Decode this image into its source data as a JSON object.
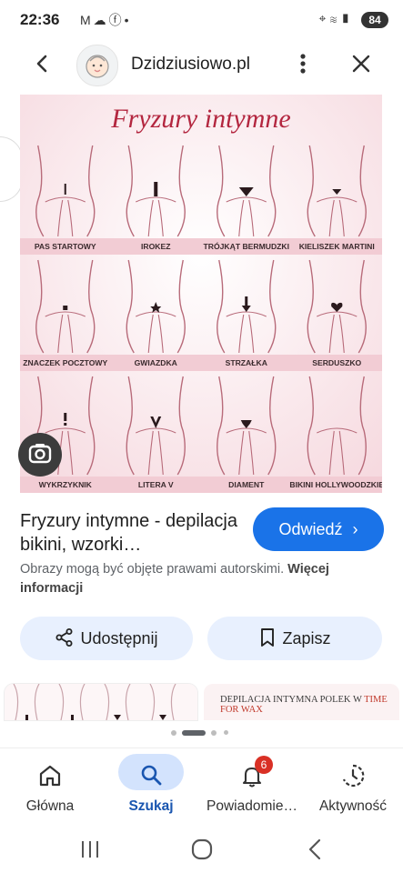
{
  "status_bar": {
    "time": "22:36",
    "battery": "84"
  },
  "header": {
    "site_name": "Dzidziusiowo.pl"
  },
  "image": {
    "heading": "Fryzury intymne",
    "styles": [
      {
        "label": "PAS STARTOWY",
        "mark": "strip"
      },
      {
        "label": "IROKEZ",
        "mark": "mohawk"
      },
      {
        "label": "TRÓJKĄT BERMUDZKI",
        "mark": "triangle"
      },
      {
        "label": "KIELISZEK MARTINI",
        "mark": "martini"
      },
      {
        "label": "ZNACZEK POCZTOWY",
        "mark": "square"
      },
      {
        "label": "GWIAZDKA",
        "mark": "star"
      },
      {
        "label": "STRZAŁKA",
        "mark": "arrow"
      },
      {
        "label": "SERDUSZKO",
        "mark": "heart"
      },
      {
        "label": "WYKRZYKNIK",
        "mark": "exclamation"
      },
      {
        "label": "LITERA V",
        "mark": "v"
      },
      {
        "label": "DIAMENT",
        "mark": "diamond"
      },
      {
        "label": "BIKINI HOLLYWOODZKIE",
        "mark": "none"
      }
    ]
  },
  "result": {
    "title": "Fryzury intymne - depilacja bikini, wzorki…",
    "visit_label": "Odwiedź",
    "copyright_text": "Obrazy mogą być objęte prawami autorskimi.",
    "more_info_label": "Więcej informacji",
    "share_label": "Udostępnij",
    "save_label": "Zapisz"
  },
  "related": {
    "second_text_a": "DEPILACJA INTYMNA POLEK W ",
    "second_text_b": "TIME FOR WAX"
  },
  "bottom_nav": {
    "items": [
      {
        "label": "Główna",
        "icon": "home-icon"
      },
      {
        "label": "Szukaj",
        "icon": "search-icon"
      },
      {
        "label": "Powiadomie…",
        "icon": "bell-icon",
        "badge": "6"
      },
      {
        "label": "Aktywność",
        "icon": "activity-icon"
      }
    ]
  },
  "colors": {
    "accent": "#1a73e8",
    "pill_bg": "#e8f0fe",
    "nav_selected_bg": "#d3e3fd",
    "badge": "#d93025",
    "image_bg": "#fbeef1",
    "label_band": "#f2ccd4",
    "heading": "#b3263f"
  }
}
